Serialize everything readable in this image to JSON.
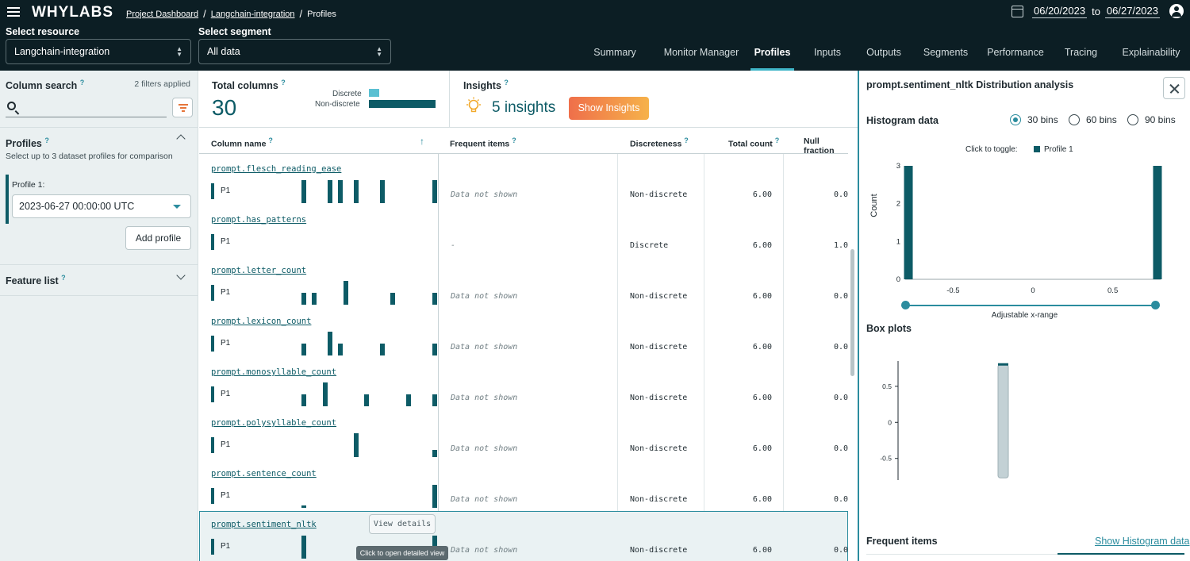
{
  "header": {
    "logo": "WHYLABS",
    "breadcrumb": [
      "Project Dashboard",
      "Langchain-integration",
      "Profiles"
    ],
    "date_from": "06/20/2023",
    "date_to_label": "to",
    "date_to": "06/27/2023",
    "resource_label": "Select resource",
    "resource_value": "Langchain-integration",
    "segment_label": "Select segment",
    "segment_value": "All data",
    "tabs": [
      "Summary",
      "Monitor Manager",
      "Profiles",
      "Inputs",
      "Outputs",
      "Segments",
      "Performance",
      "Tracing",
      "Explainability"
    ],
    "active_tab": "Profiles"
  },
  "sidebar": {
    "column_search_title": "Column search",
    "filters_applied": "2 filters applied",
    "search_value": "",
    "profiles_title": "Profiles",
    "profiles_subtitle": "Select up to 3 dataset profiles for comparison",
    "profile1_label": "Profile 1:",
    "profile1_value": "2023-06-27 00:00:00 UTC",
    "add_profile": "Add profile",
    "feature_list": "Feature list"
  },
  "summary": {
    "total_columns_title": "Total columns",
    "total_columns": "30",
    "discrete_label": "Discrete",
    "non_discrete_label": "Non-discrete",
    "insights_title": "Insights",
    "insights_count": "5 insights",
    "show_insights": "Show Insights"
  },
  "table": {
    "headers": {
      "column_name": "Column name",
      "frequent_items": "Frequent items",
      "discreteness": "Discreteness",
      "total_count": "Total count",
      "null_fraction": "Null fraction"
    },
    "profile_tag": "P1",
    "view_details": "View details",
    "tooltip": "Click to open detailed view",
    "rows": [
      {
        "name": "prompt.flesch_reading_ease",
        "freq": "Data not shown",
        "disc": "Non-discrete",
        "total": "6.00",
        "nullf": "0.0",
        "spark": [
          0.0,
          0.0,
          0.0,
          0.0,
          0.0,
          0.0,
          0.0,
          0.0,
          0.0,
          0.95,
          0.0,
          0.0,
          0.0,
          0.0,
          0.95,
          0.0,
          0.95,
          0.0,
          0.0,
          0.95,
          0.0,
          0.0,
          0.0,
          0.0,
          0.95,
          0.0,
          0.0,
          0.0,
          0.0,
          0.0,
          0.0,
          0.0,
          0.0,
          0.0,
          0.95
        ]
      },
      {
        "name": "prompt.has_patterns",
        "freq": "-",
        "disc": "Discrete",
        "total": "6.00",
        "nullf": "1.0",
        "spark": []
      },
      {
        "name": "prompt.letter_count",
        "freq": "Data not shown",
        "disc": "Non-discrete",
        "total": "6.00",
        "nullf": "0.0",
        "spark": [
          0.0,
          0.0,
          0.0,
          0.0,
          0.0,
          0.0,
          0.0,
          0.0,
          0.0,
          0.5,
          0.0,
          0.5,
          0.0,
          0.0,
          0.0,
          0.0,
          0.0,
          1.0,
          0.0,
          0.0,
          0.0,
          0.0,
          0.0,
          0.0,
          0.0,
          0.0,
          0.5,
          0.0,
          0.0,
          0.0,
          0.0,
          0.0,
          0.0,
          0.0,
          0.5
        ]
      },
      {
        "name": "prompt.lexicon_count",
        "freq": "Data not shown",
        "disc": "Non-discrete",
        "total": "6.00",
        "nullf": "0.0",
        "spark": [
          0.0,
          0.0,
          0.0,
          0.0,
          0.0,
          0.0,
          0.0,
          0.0,
          0.0,
          0.5,
          0.0,
          0.0,
          0.0,
          0.0,
          1.0,
          0.0,
          0.5,
          0.0,
          0.0,
          0.0,
          0.0,
          0.0,
          0.0,
          0.0,
          0.5,
          0.0,
          0.0,
          0.0,
          0.0,
          0.0,
          0.0,
          0.0,
          0.0,
          0.0,
          0.5
        ]
      },
      {
        "name": "prompt.monosyllable_count",
        "freq": "Data not shown",
        "disc": "Non-discrete",
        "total": "6.00",
        "nullf": "0.0",
        "spark": [
          0.0,
          0.0,
          0.0,
          0.0,
          0.0,
          0.0,
          0.0,
          0.0,
          0.0,
          0.5,
          0.0,
          0.0,
          0.0,
          1.0,
          0.0,
          0.0,
          0.0,
          0.0,
          0.0,
          0.0,
          0.0,
          0.5,
          0.0,
          0.0,
          0.0,
          0.0,
          0.0,
          0.0,
          0.0,
          0.5,
          0.0,
          0.0,
          0.0,
          0.0,
          0.5
        ]
      },
      {
        "name": "prompt.polysyllable_count",
        "freq": "Data not shown",
        "disc": "Non-discrete",
        "total": "6.00",
        "nullf": "0.0",
        "spark": [
          0.0,
          0.0,
          0.0,
          0.0,
          0.0,
          0.0,
          0.0,
          0.0,
          0.0,
          0.0,
          0.0,
          0.0,
          0.0,
          0.0,
          0.0,
          0.0,
          0.0,
          0.0,
          0.0,
          1.0,
          0.0,
          0.0,
          0.0,
          0.0,
          0.0,
          0.0,
          0.0,
          0.0,
          0.0,
          0.0,
          0.0,
          0.0,
          0.0,
          0.0,
          0.3
        ]
      },
      {
        "name": "prompt.sentence_count",
        "freq": "Data not shown",
        "disc": "Non-discrete",
        "total": "6.00",
        "nullf": "0.0",
        "spark": [
          0.0,
          0.0,
          0.0,
          0.0,
          0.0,
          0.0,
          0.0,
          0.0,
          0.0,
          0.1,
          0.0,
          0.0,
          0.0,
          0.0,
          0.0,
          0.0,
          0.0,
          0.0,
          0.0,
          0.0,
          0.0,
          0.0,
          0.0,
          0.0,
          0.0,
          0.0,
          0.0,
          0.0,
          0.0,
          0.0,
          0.0,
          0.0,
          0.0,
          0.0,
          0.95
        ]
      },
      {
        "name": "prompt.sentiment_nltk",
        "freq": "Data not shown",
        "disc": "Non-discrete",
        "total": "6.00",
        "nullf": "0.0",
        "spark": [
          0.0,
          0.0,
          0.0,
          0.0,
          0.0,
          0.0,
          0.0,
          0.0,
          0.0,
          0.95,
          0.0,
          0.0,
          0.0,
          0.0,
          0.0,
          0.0,
          0.0,
          0.0,
          0.0,
          0.0,
          0.0,
          0.0,
          0.0,
          0.0,
          0.0,
          0.0,
          0.0,
          0.0,
          0.0,
          0.0,
          0.0,
          0.0,
          0.0,
          0.0,
          0.95
        ]
      }
    ]
  },
  "details": {
    "title": "prompt.sentiment_nltk Distribution analysis",
    "histogram_title": "Histogram data",
    "bins": [
      "30 bins",
      "60 bins",
      "90 bins"
    ],
    "selected_bins": "30 bins",
    "toggle_label": "Click to toggle:",
    "profile_name": "Profile 1",
    "range_label": "Adjustable x-range",
    "box_plots_title": "Box plots",
    "frequent_items_title": "Frequent items",
    "show_histogram": "Show Histogram data",
    "colors": {
      "series": "#0d5b66",
      "accent": "#2b8c9e"
    }
  },
  "chart_data": [
    {
      "type": "bar",
      "x_ticks": [
        "-0.5",
        "0",
        "0.5"
      ],
      "y_ticks": [
        "0",
        "1",
        "2",
        "3"
      ],
      "ylabel": "Count",
      "xlim": [
        -0.8,
        0.8
      ],
      "ylim": [
        0,
        3
      ],
      "series": [
        {
          "name": "Profile 1",
          "x": [
            -0.78,
            0.78
          ],
          "values": [
            3,
            3
          ]
        }
      ]
    },
    {
      "type": "box",
      "y_ticks": [
        "0.5",
        "0",
        "-0.5"
      ],
      "ylim": [
        -0.8,
        0.85
      ],
      "box": {
        "min": -0.77,
        "q1": -0.77,
        "median": 0.8,
        "q3": 0.8,
        "max": 0.82
      }
    }
  ]
}
